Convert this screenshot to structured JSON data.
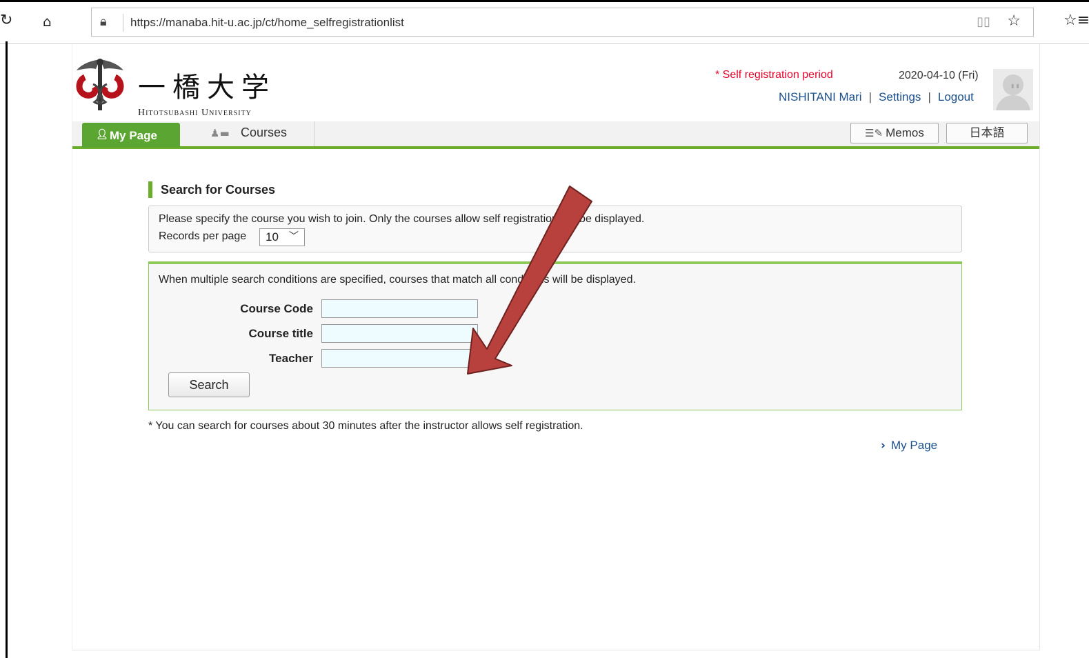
{
  "browser": {
    "url": "https://manaba.hit-u.ac.jp/ct/home_selfregistrationlist"
  },
  "header": {
    "logo_kanji": "一橋大学",
    "logo_en": "Hitotsubashi University",
    "self_registration": "* Self registration period",
    "date": "2020-04-10 (Fri)",
    "user_name": "NISHITANI Mari",
    "settings": "Settings",
    "logout": "Logout"
  },
  "nav": {
    "my_page": "My Page",
    "courses": "Courses",
    "memos": "Memos",
    "language": "日本語"
  },
  "content": {
    "title": "Search for Courses",
    "info_text": "Please specify the course you wish to join. Only the courses allow self registration will be displayed.",
    "records_label": "Records per page",
    "records_value": "10",
    "search_note": "When multiple search conditions are specified, courses that match all conditions will be displayed.",
    "fields": {
      "course_code": "Course Code",
      "course_title": "Course title",
      "teacher": "Teacher"
    },
    "search_button": "Search",
    "footnote": "* You can search for courses about 30 minutes after the instructor allows self registration.",
    "mypage_link": "My Page"
  },
  "colors": {
    "accent_green": "#6aae2b",
    "link_blue": "#1a4f8b",
    "alert_red": "#e8002a",
    "annotation_arrow": "#b8413e"
  }
}
